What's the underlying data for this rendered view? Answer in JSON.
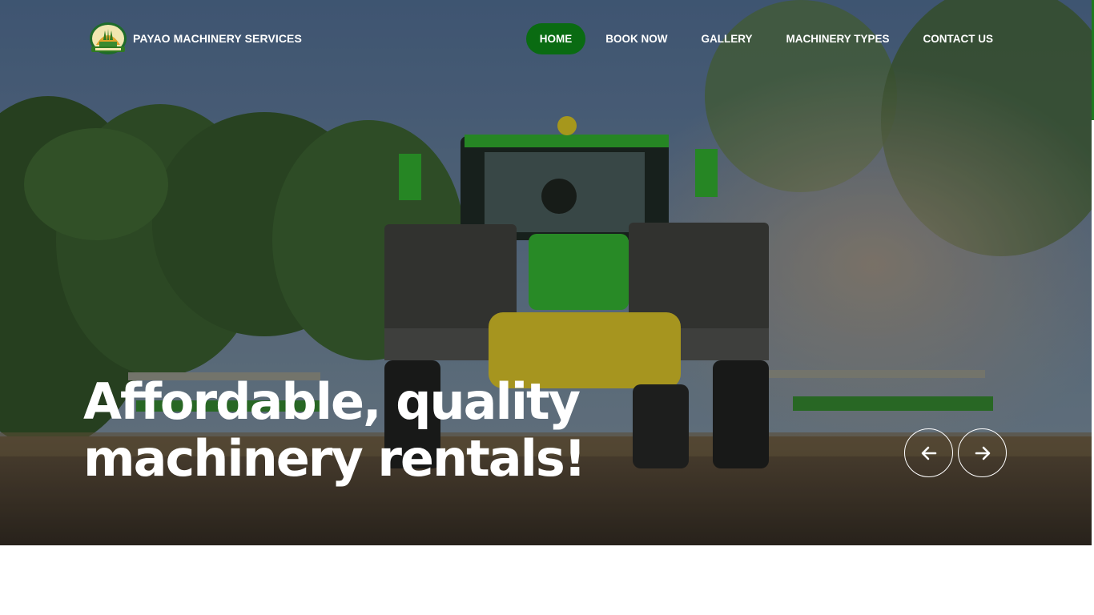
{
  "brand": {
    "name": "PAYAO MACHINERY SERVICES",
    "logo_icon": "farm-crest-logo-icon"
  },
  "nav": {
    "items": [
      {
        "label": "HOME",
        "active": true
      },
      {
        "label": "BOOK NOW",
        "active": false
      },
      {
        "label": "GALLERY",
        "active": false
      },
      {
        "label": "MACHINERY TYPES",
        "active": false
      },
      {
        "label": "CONTACT US",
        "active": false
      }
    ]
  },
  "hero": {
    "headline_line1": "Affordable, quality",
    "headline_line2": "machinery rentals!",
    "image": "green-tractor-in-field-photo",
    "prev_icon": "arrow-left-icon",
    "next_icon": "arrow-right-icon"
  },
  "colors": {
    "accent_green": "#0a6b12",
    "text_white": "#ffffff"
  }
}
